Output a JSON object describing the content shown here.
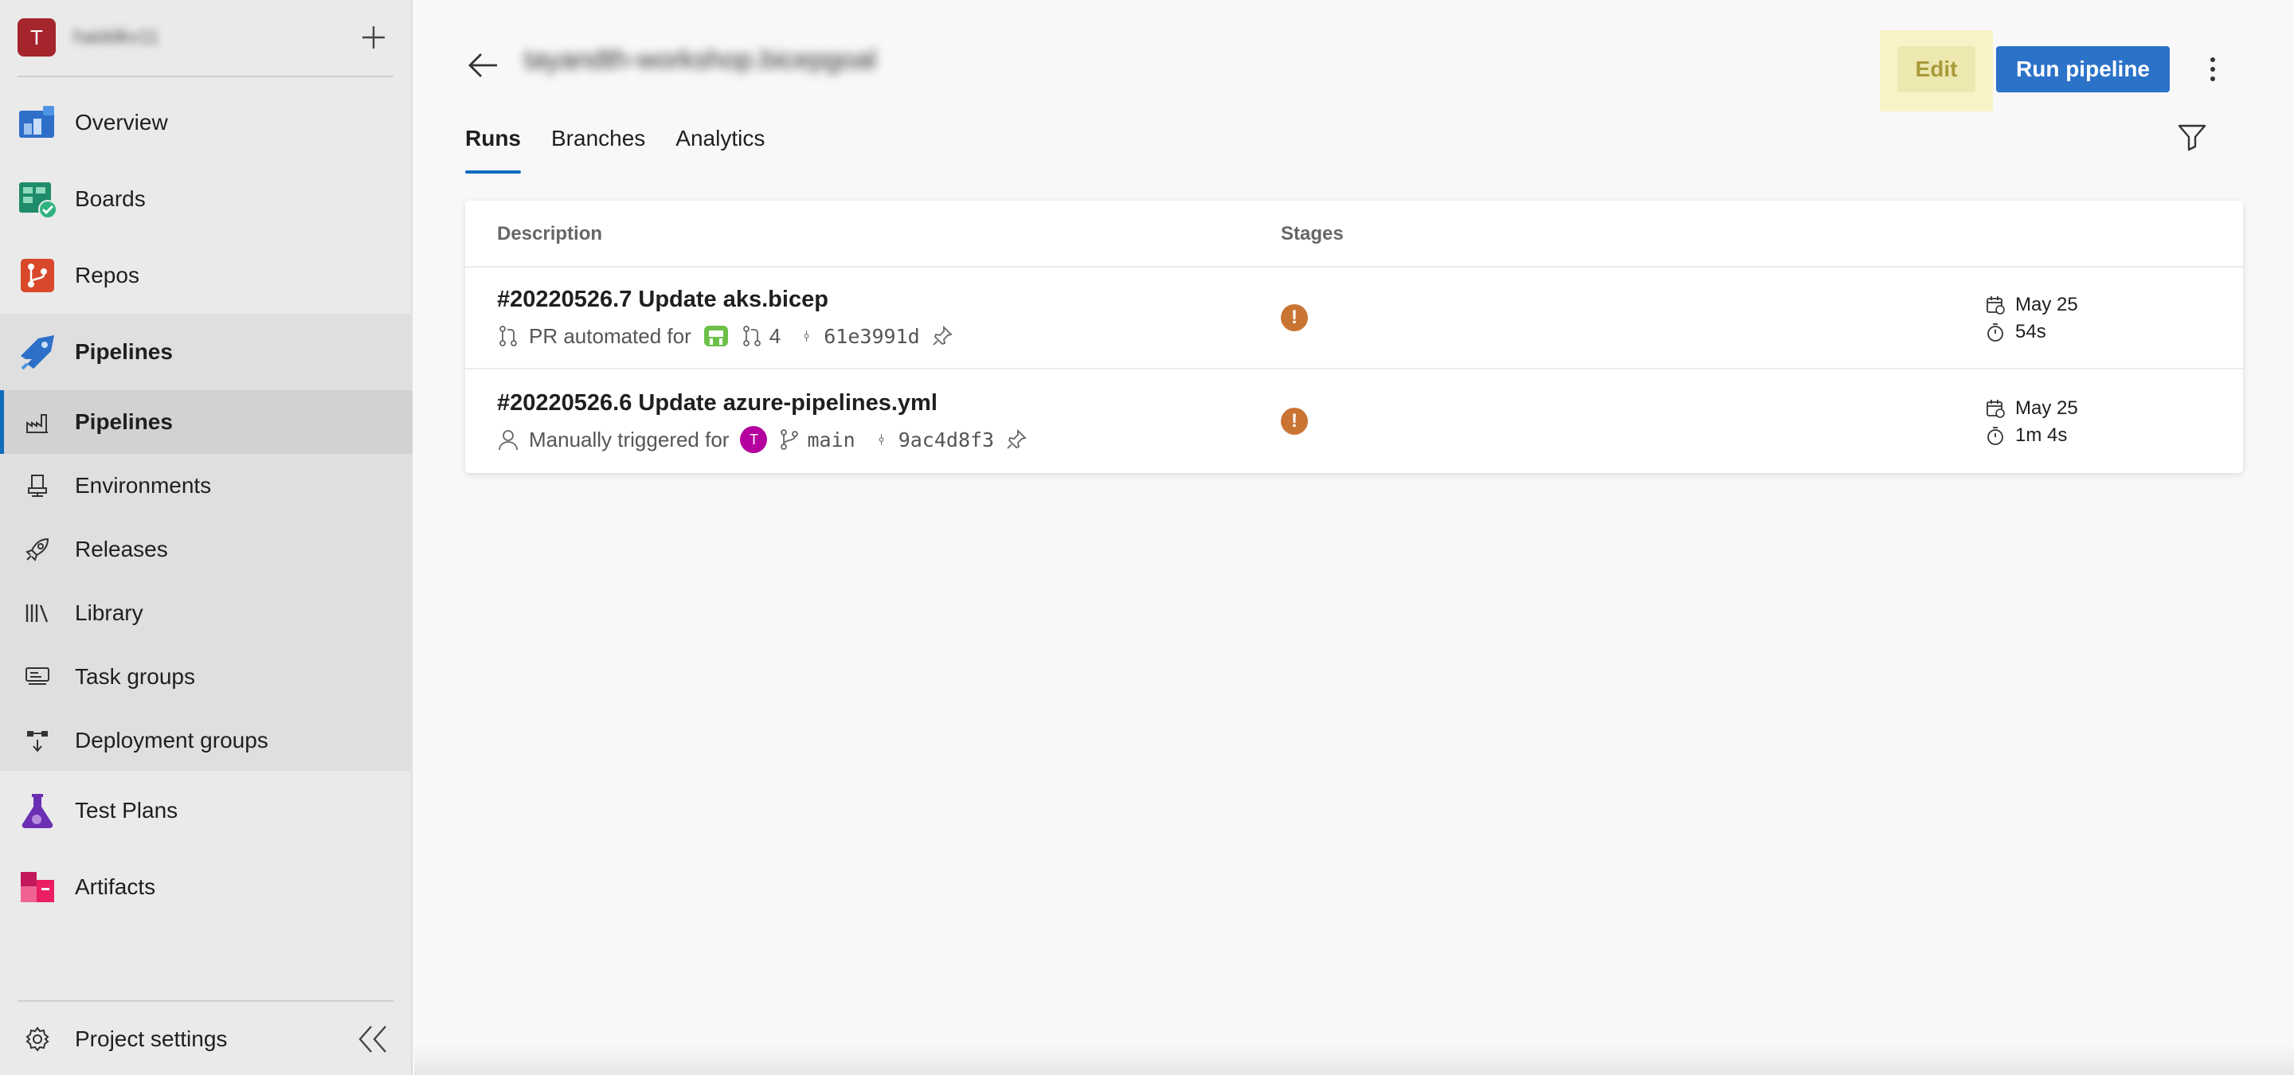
{
  "org": {
    "avatar_letter": "T",
    "name": "haiddkv11"
  },
  "sidebar": {
    "main_items": [
      {
        "label": "Overview"
      },
      {
        "label": "Boards"
      },
      {
        "label": "Repos"
      },
      {
        "label": "Pipelines"
      }
    ],
    "sub_items": [
      {
        "label": "Pipelines"
      },
      {
        "label": "Environments"
      },
      {
        "label": "Releases"
      },
      {
        "label": "Library"
      },
      {
        "label": "Task groups"
      },
      {
        "label": "Deployment groups"
      }
    ],
    "after_items": [
      {
        "label": "Test Plans"
      },
      {
        "label": "Artifacts"
      }
    ],
    "settings_label": "Project settings"
  },
  "header": {
    "pipeline_name": "tayandth-workshop.bicepgoal",
    "edit_label": "Edit",
    "run_label": "Run pipeline"
  },
  "tabs": [
    {
      "label": "Runs"
    },
    {
      "label": "Branches"
    },
    {
      "label": "Analytics"
    }
  ],
  "table": {
    "columns": {
      "description": "Description",
      "stages": "Stages"
    },
    "rows": [
      {
        "title": "#20220526.7 Update aks.bicep",
        "trigger": "PR automated for",
        "pr_number": "4",
        "commit": "61e3991d",
        "date": "May 25",
        "duration": "54s",
        "stage_status": "warning"
      },
      {
        "title": "#20220526.6 Update azure-pipelines.yml",
        "trigger": "Manually triggered for",
        "avatar_letter": "T",
        "branch": "main",
        "commit": "9ac4d8f3",
        "date": "May 25",
        "duration": "1m 4s",
        "stage_status": "warning"
      }
    ]
  },
  "colors": {
    "accent": "#0f6cbd",
    "run_button": "#2b72c9",
    "warning": "#ca7434",
    "edit_highlight": "#f7f3c6"
  }
}
